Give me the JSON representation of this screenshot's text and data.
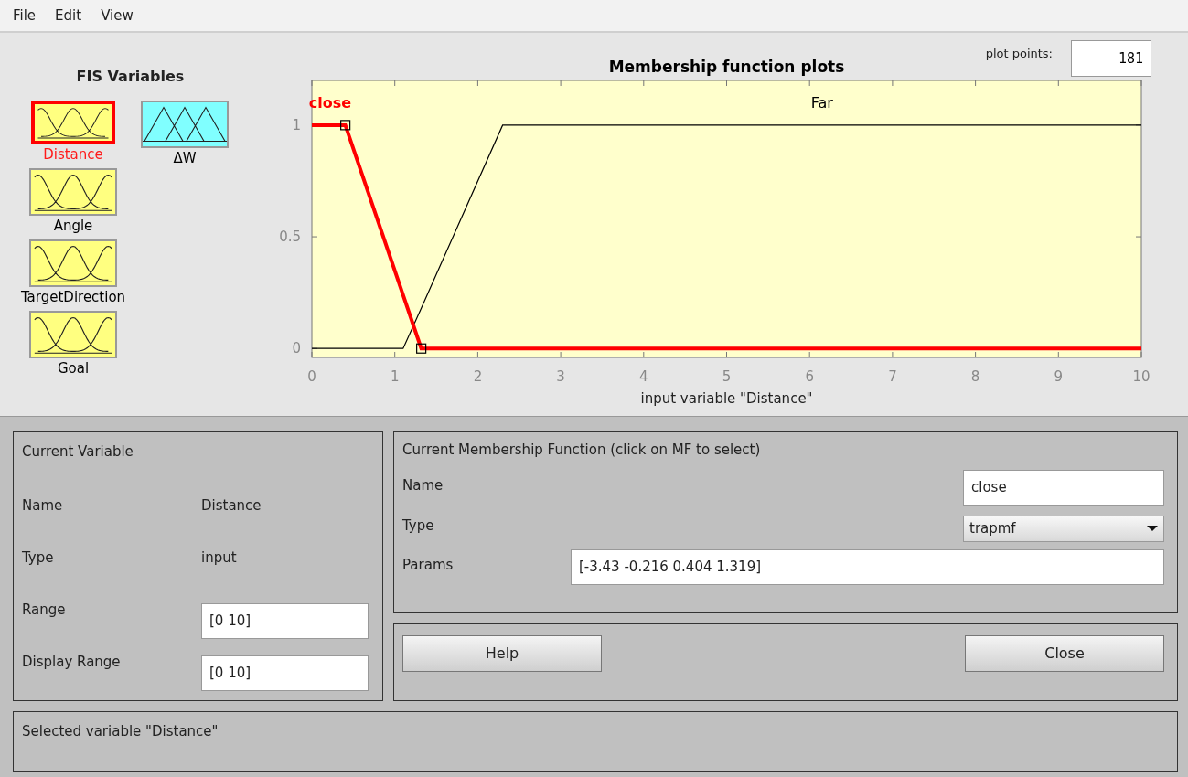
{
  "menu": [
    "File",
    "Edit",
    "View"
  ],
  "fis_variables": {
    "title": "FIS Variables",
    "inputs": [
      {
        "name": "Distance",
        "selected": true,
        "kind": "input"
      },
      {
        "name": "Angle",
        "selected": false,
        "kind": "input"
      },
      {
        "name": "TargetDirection",
        "selected": false,
        "kind": "input"
      },
      {
        "name": "Goal",
        "selected": false,
        "kind": "input"
      }
    ],
    "outputs": [
      {
        "name": "ΔW",
        "selected": false,
        "kind": "output"
      }
    ]
  },
  "plot_points": {
    "label": "plot points:",
    "value": "181"
  },
  "plot": {
    "chart_data": {
      "type": "line",
      "title": "Membership function plots",
      "xlabel": "input variable \"Distance\"",
      "x": [
        0,
        0.404,
        1.1,
        1.319,
        2.3,
        10
      ],
      "series": [
        {
          "name": "close",
          "color": "#ff0000",
          "values": [
            1,
            1,
            0.239,
            0,
            0,
            0
          ]
        },
        {
          "name": "Far",
          "color": "#000000",
          "values": [
            0,
            0,
            0,
            0.18,
            1,
            1
          ]
        }
      ],
      "xlim": [
        0,
        10
      ],
      "ylim": [
        -0.04,
        1.2
      ],
      "xticks": [
        0,
        1,
        2,
        3,
        4,
        5,
        6,
        7,
        8,
        9,
        10
      ],
      "yticks": [
        0,
        {
          "value": 0.5,
          "label": "0.5"
        },
        1
      ]
    },
    "curves": [
      {
        "selected": true
      },
      {
        "selected": false
      }
    ]
  },
  "current_variable": {
    "title": "Current Variable",
    "rows": [
      {
        "label": "Name",
        "value": "Distance",
        "kind": "text"
      },
      {
        "label": "Type",
        "value": "input",
        "kind": "text"
      },
      {
        "label": "Range",
        "value": "[0 10]",
        "kind": "field"
      },
      {
        "label": "Display Range",
        "value": "[0 10]",
        "kind": "field"
      }
    ]
  },
  "current_mf": {
    "title": "Current Membership Function (click on MF to select)",
    "name": {
      "label": "Name",
      "value": "close"
    },
    "type": {
      "label": "Type",
      "value": "trapmf"
    },
    "params": {
      "label": "Params",
      "value": "[-3.43 -0.216 0.404 1.319]"
    }
  },
  "buttons": [
    "Help",
    "Close"
  ],
  "status": "Selected variable \"Distance\""
}
